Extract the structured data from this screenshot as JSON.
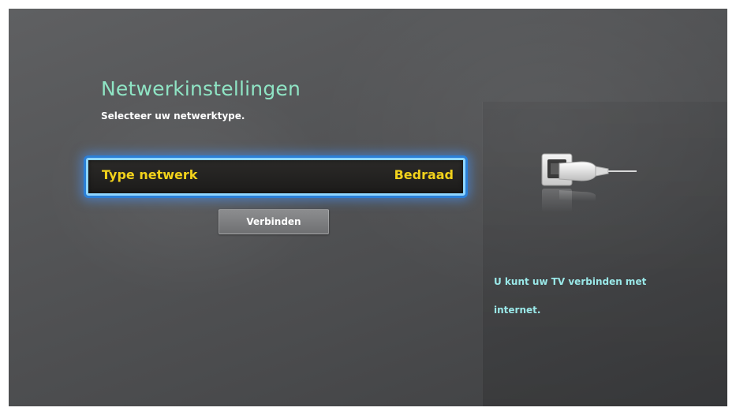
{
  "window": {
    "title": "Netwerkinstellingen",
    "subtitle": "Selecteer uw netwerktype."
  },
  "settings": {
    "network_type_label": "Type netwerk",
    "network_type_value": "Bedraad"
  },
  "actions": {
    "connect_label": "Verbinden"
  },
  "info_panel": {
    "line1": "U kunt uw TV verbinden met",
    "line2": "internet.",
    "illustration_icon": "ethernet-plug-icon"
  },
  "colors": {
    "title": "#8fe4c4",
    "highlight_text": "#f2d21b",
    "focus_border": "#8fd6ff",
    "info_text": "#9ae8e8"
  }
}
